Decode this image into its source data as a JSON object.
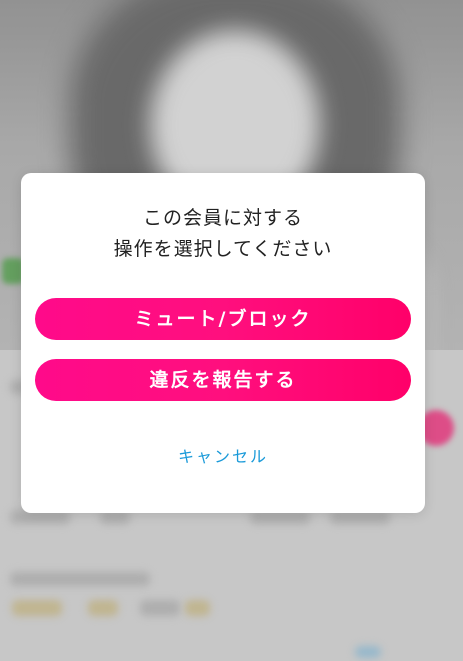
{
  "dialog": {
    "title_line1": "この会員に対する",
    "title_line2": "操作を選択してください",
    "mute_block_label": "ミュート/ブロック",
    "report_label": "違反を報告する",
    "cancel_label": "キャンセル"
  },
  "colors": {
    "primary_button": "#ff0a82",
    "cancel_link": "#1a9ad9",
    "dialog_background": "#ffffff"
  }
}
